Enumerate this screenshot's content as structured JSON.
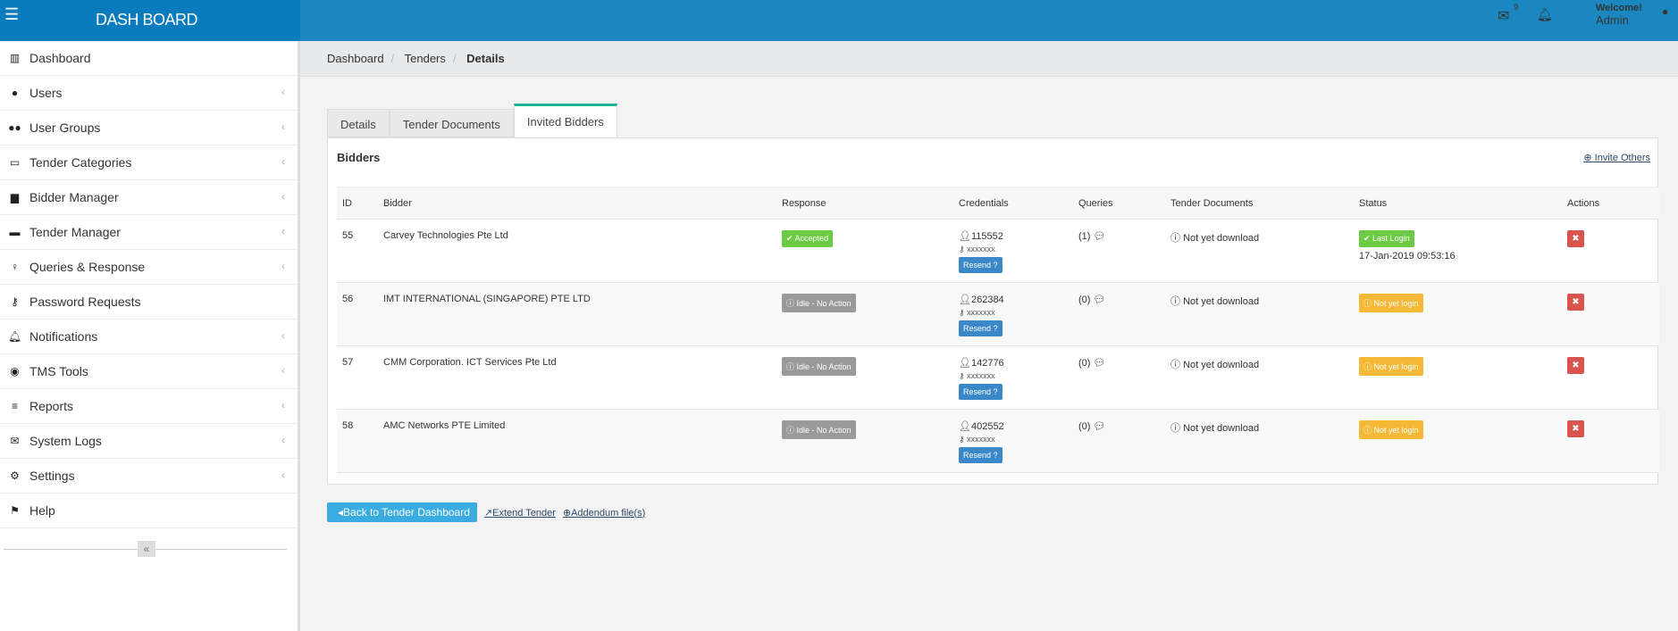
{
  "header": {
    "brand": "DASH BOARD",
    "mail_count": "9",
    "welcome": "Welcome!",
    "user": "Admin"
  },
  "sidebar": {
    "items": [
      {
        "label": "Dashboard",
        "icon": "bar-chart-icon",
        "glyph": "▥",
        "chev": false
      },
      {
        "label": "Users",
        "icon": "user-icon",
        "glyph": "●",
        "chev": true
      },
      {
        "label": "User Groups",
        "icon": "users-icon",
        "glyph": "●●",
        "chev": true
      },
      {
        "label": "Tender Categories",
        "icon": "laptop-icon",
        "glyph": "▭",
        "chev": true
      },
      {
        "label": "Bidder Manager",
        "icon": "truck-icon",
        "glyph": "▆",
        "chev": true
      },
      {
        "label": "Tender Manager",
        "icon": "desktop-icon",
        "glyph": "▬",
        "chev": true
      },
      {
        "label": "Queries & Response",
        "icon": "lightbulb-icon",
        "glyph": "♀",
        "chev": true
      },
      {
        "label": "Password Requests",
        "icon": "key-icon",
        "glyph": "⚷",
        "chev": false
      },
      {
        "label": "Notifications",
        "icon": "bell-icon",
        "glyph": "🔔︎",
        "chev": true
      },
      {
        "label": "TMS Tools",
        "icon": "target-icon",
        "glyph": "◉",
        "chev": true
      },
      {
        "label": "Reports",
        "icon": "align-left-icon",
        "glyph": "≡",
        "chev": true
      },
      {
        "label": "System Logs",
        "icon": "envelope-icon",
        "glyph": "✉",
        "chev": true
      },
      {
        "label": "Settings",
        "icon": "gear-icon",
        "glyph": "⚙",
        "chev": true
      },
      {
        "label": "Help",
        "icon": "flag-icon",
        "glyph": "⚑",
        "chev": false
      }
    ],
    "collapse": "«"
  },
  "breadcrumb": [
    "Dashboard",
    "Tenders",
    "Details"
  ],
  "tabs": [
    "Details",
    "Tender Documents",
    "Invited Bidders"
  ],
  "panel": {
    "title": "Bidders",
    "invite": "Invite Others"
  },
  "table": {
    "headers": [
      "ID",
      "Bidder",
      "Response",
      "Credentials",
      "Queries",
      "Tender Documents",
      "Status",
      "Actions"
    ],
    "rows": [
      {
        "id": "55",
        "bidder": "Carvey Technologies Pte Ltd",
        "response": "✔ Accepted",
        "response_color": "#6ccb45",
        "user": "115552",
        "password": "xxxxxxx",
        "resend": "Resend ?",
        "queries": "(1)",
        "docs": "Not yet download",
        "status": "Last Login",
        "status_color": "#6ccb45",
        "status_time": "17-Jan-2019 09:53:16"
      },
      {
        "id": "56",
        "bidder": "IMT INTERNATIONAL (SINGAPORE) PTE LTD",
        "response": "Idle - No Action",
        "response_color": "#9a9a9a",
        "user": "262384",
        "password": "xxxxxxx",
        "resend": "Resend ?",
        "queries": "(0)",
        "docs": "Not yet download",
        "status": "Not yet login",
        "status_color": "#f5b937",
        "status_time": ""
      },
      {
        "id": "57",
        "bidder": "CMM Corporation. ICT Services Pte Ltd",
        "response": "Idle - No Action",
        "response_color": "#9a9a9a",
        "user": "142776",
        "password": "xxxxxxx",
        "resend": "Resend ?",
        "queries": "(0)",
        "docs": "Not yet download",
        "status": "Not yet login",
        "status_color": "#f5b937",
        "status_time": ""
      },
      {
        "id": "58",
        "bidder": "AMC Networks PTE Limited",
        "response": "Idle - No Action",
        "response_color": "#9a9a9a",
        "user": "402552",
        "password": "xxxxxxx",
        "resend": "Resend ?",
        "queries": "(0)",
        "docs": "Not yet download",
        "status": "Not yet login",
        "status_color": "#f5b937",
        "status_time": ""
      }
    ]
  },
  "footer": {
    "back": "Back to Tender Dashboard",
    "extend": "Extend Tender",
    "addendum": "Addendum file(s)"
  }
}
